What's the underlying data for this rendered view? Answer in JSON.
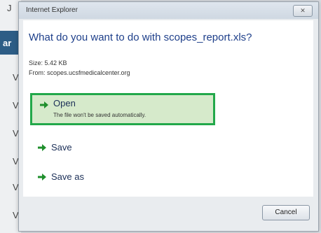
{
  "window": {
    "title": "Internet Explorer",
    "close_label": "✕"
  },
  "dialog": {
    "question": "What do you want to do with scopes_report.xls?",
    "size_line": "Size: 5.42 KB",
    "from_line": "From: scopes.ucsfmedicalcenter.org"
  },
  "options": {
    "open_label": "Open",
    "open_sub": "The file won't be saved automatically.",
    "save_label": "Save",
    "saveas_label": "Save as"
  },
  "footer": {
    "cancel_label": "Cancel"
  },
  "background": {
    "glyph_top": "J",
    "glyph_band": "ar",
    "glyph_rows": [
      "V",
      "V",
      "V",
      "V",
      "V",
      "V"
    ]
  },
  "colors": {
    "accent_green": "#22a84a",
    "arrow_green": "#1f8f2c",
    "question_blue": "#1e3f8a"
  },
  "icons": {
    "option_arrow": "green-arrow-icon"
  }
}
